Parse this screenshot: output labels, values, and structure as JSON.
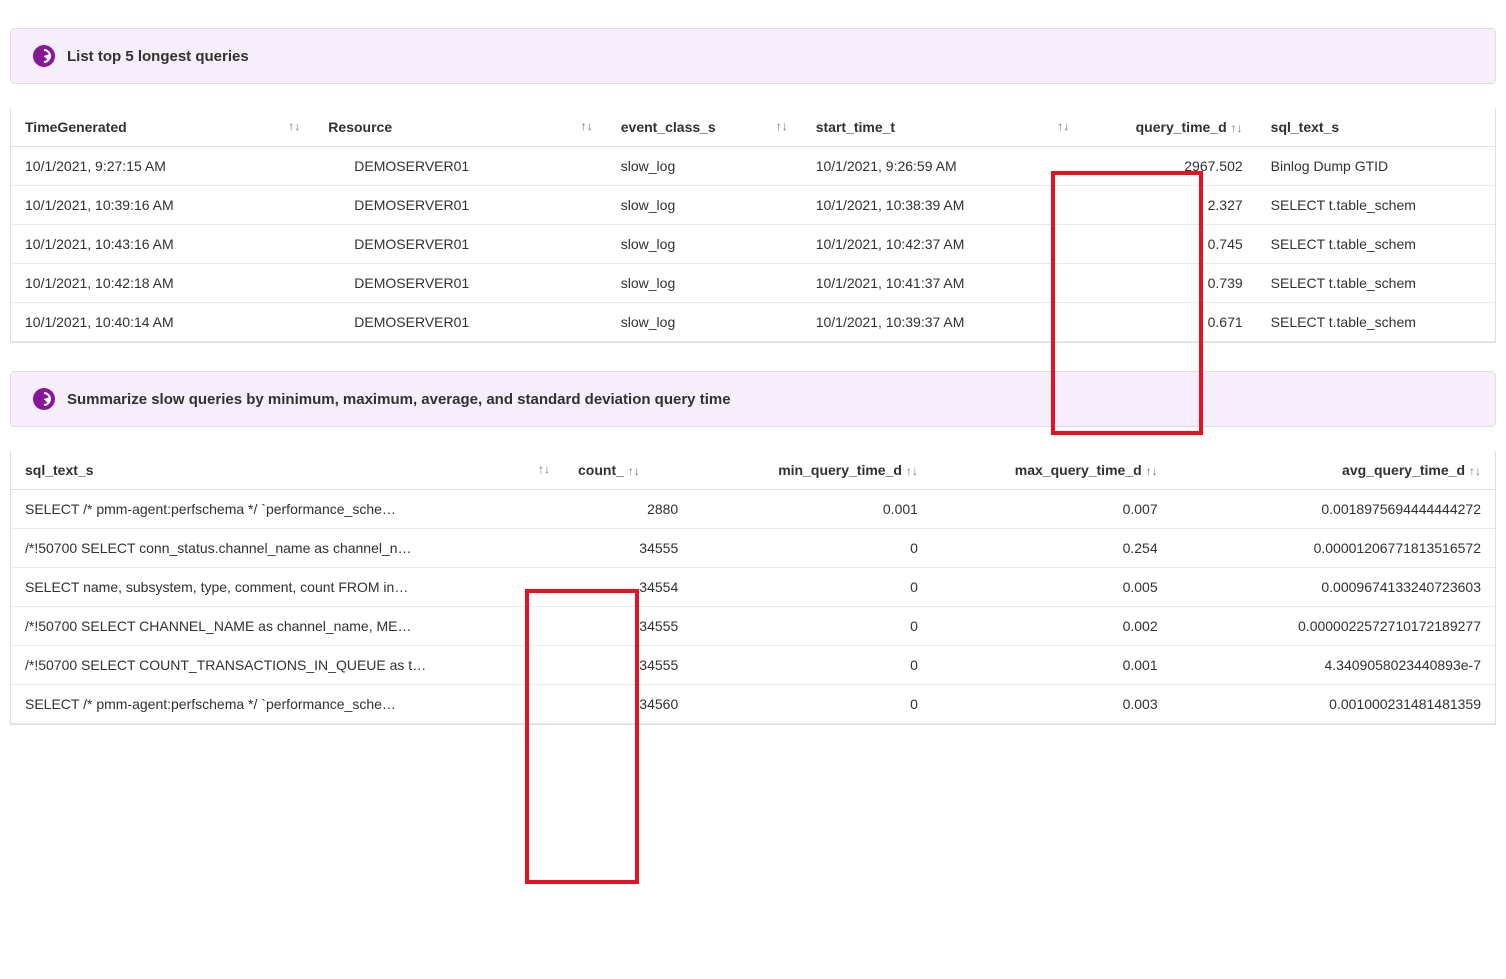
{
  "panel1": {
    "title": "List top 5 longest queries"
  },
  "table1": {
    "columns": {
      "time": "TimeGenerated",
      "resource": "Resource",
      "event": "event_class_s",
      "start": "start_time_t",
      "qtime": "query_time_d",
      "sql": "sql_text_s"
    },
    "rows": [
      {
        "time": "10/1/2021, 9:27:15 AM",
        "resource": "DEMOSERVER01",
        "event": "slow_log",
        "start": "10/1/2021, 9:26:59 AM",
        "qtime": "2967.502",
        "sql": "Binlog Dump GTID"
      },
      {
        "time": "10/1/2021, 10:39:16 AM",
        "resource": "DEMOSERVER01",
        "event": "slow_log",
        "start": "10/1/2021, 10:38:39 AM",
        "qtime": "2.327",
        "sql": "SELECT t.table_schem"
      },
      {
        "time": "10/1/2021, 10:43:16 AM",
        "resource": "DEMOSERVER01",
        "event": "slow_log",
        "start": "10/1/2021, 10:42:37 AM",
        "qtime": "0.745",
        "sql": "SELECT t.table_schem"
      },
      {
        "time": "10/1/2021, 10:42:18 AM",
        "resource": "DEMOSERVER01",
        "event": "slow_log",
        "start": "10/1/2021, 10:41:37 AM",
        "qtime": "0.739",
        "sql": "SELECT t.table_schem"
      },
      {
        "time": "10/1/2021, 10:40:14 AM",
        "resource": "DEMOSERVER01",
        "event": "slow_log",
        "start": "10/1/2021, 10:39:37 AM",
        "qtime": "0.671",
        "sql": "SELECT t.table_schem"
      }
    ]
  },
  "panel2": {
    "title": "Summarize slow queries by minimum, maximum, average, and standard deviation query time"
  },
  "table2": {
    "columns": {
      "sql": "sql_text_s",
      "count": "count_",
      "min": "min_query_time_d",
      "max": "max_query_time_d",
      "avg": "avg_query_time_d"
    },
    "rows": [
      {
        "sql": "SELECT /* pmm-agent:perfschema */ `performance_sche…",
        "count": "2880",
        "min": "0.001",
        "max": "0.007",
        "avg": "0.0018975694444444272"
      },
      {
        "sql": "/*!50700 SELECT conn_status.channel_name as channel_n…",
        "count": "34555",
        "min": "0",
        "max": "0.254",
        "avg": "0.00001206771813516572"
      },
      {
        "sql": "SELECT name, subsystem, type, comment, count FROM in…",
        "count": "34554",
        "min": "0",
        "max": "0.005",
        "avg": "0.0009674133240723603"
      },
      {
        "sql": "/*!50700 SELECT CHANNEL_NAME as channel_name, ME…",
        "count": "34555",
        "min": "0",
        "max": "0.002",
        "avg": "0.0000022572710172189277"
      },
      {
        "sql": "/*!50700 SELECT COUNT_TRANSACTIONS_IN_QUEUE as t…",
        "count": "34555",
        "min": "0",
        "max": "0.001",
        "avg": "4.3409058023440893e-7"
      },
      {
        "sql": "SELECT /* pmm-agent:perfschema */ `performance_sche…",
        "count": "34560",
        "min": "0",
        "max": "0.003",
        "avg": "0.001000231481481359"
      }
    ]
  },
  "sort_glyph": "↑↓"
}
